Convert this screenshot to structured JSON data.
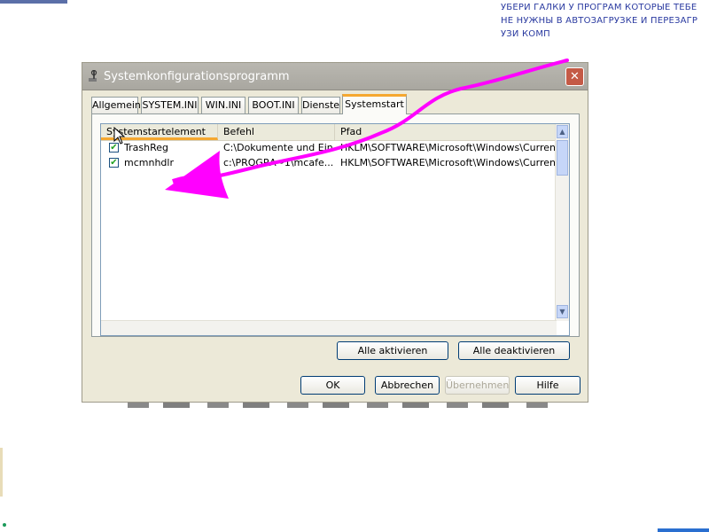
{
  "annotation": {
    "lines": [
      "УБЕРИ ГАЛКИ У ПРОГРАМ КОТОРЫЕ ТЕБЕ",
      "НЕ НУЖНЫ В АВТОЗАГРУЗКЕ И ПЕРЕЗАГР",
      "УЗИ КОМП"
    ],
    "color": "#2a3aa0",
    "marker_color": "#ff00ff"
  },
  "window": {
    "title": "Systemkonfigurationsprogramm",
    "icon": "wrench-icon",
    "close_glyph": "✕"
  },
  "tabs": [
    {
      "label": "Allgemein",
      "active": false
    },
    {
      "label": "SYSTEM.INI",
      "active": false
    },
    {
      "label": "WIN.INI",
      "active": false
    },
    {
      "label": "BOOT.INI",
      "active": false
    },
    {
      "label": "Dienste",
      "active": false
    },
    {
      "label": "Systemstart",
      "active": true
    }
  ],
  "startup_list": {
    "columns": [
      "Systemstartelement",
      "Befehl",
      "Pfad"
    ],
    "sorted_column": "Systemstartelement",
    "rows": [
      {
        "checked": true,
        "element": "TrashReg",
        "command": "C:\\Dokumente und Ein...",
        "path": "HKLM\\SOFTWARE\\Microsoft\\Windows\\CurrentVer..."
      },
      {
        "checked": true,
        "element": "mcmnhdlr",
        "command": "c:\\PROGRA~1\\mcafe...",
        "path": "HKLM\\SOFTWARE\\Microsoft\\Windows\\CurrentVer..."
      }
    ]
  },
  "buttons": {
    "enable_all": "Alle aktivieren",
    "disable_all": "Alle deaktivieren",
    "ok": "OK",
    "cancel": "Abbrechen",
    "apply": "Übernehmen",
    "help": "Hilfe"
  },
  "colors": {
    "tab_accent": "#f5a830",
    "titlebar": "#b0aea7",
    "close_button": "#c45a46",
    "checkmark": "#21a121"
  }
}
